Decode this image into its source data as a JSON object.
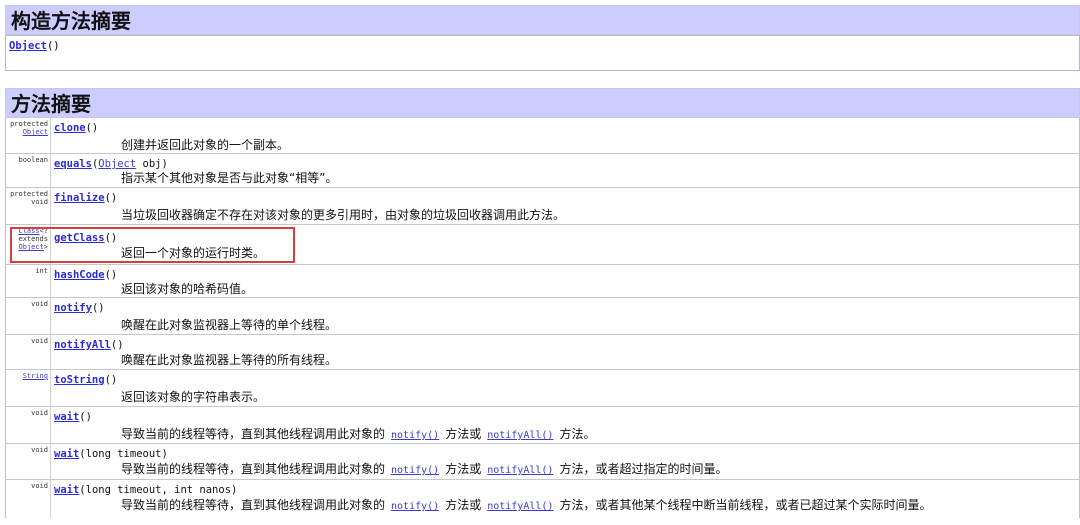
{
  "constructor_summary": {
    "title": "构造方法摘要",
    "constructor_link": "Object",
    "constructor_suffix": "()"
  },
  "method_summary": {
    "title": "方法摘要",
    "rows": [
      {
        "mod_line1": "protected",
        "mod_type": "Object",
        "name": "clone",
        "params": "()",
        "desc": "创建并返回此对象的一个副本。"
      },
      {
        "mod_line1": "boolean",
        "name": "equals",
        "params_prefix": "(",
        "param_type": "Object",
        "params_suffix": " obj)",
        "desc": "指示某个其他对象是否与此对象“相等”。"
      },
      {
        "mod_line1": "protected",
        "mod_line2": "void",
        "name": "finalize",
        "params": "()",
        "desc": "当垃圾回收器确定不存在对该对象的更多引用时，由对象的垃圾回收器调用此方法。"
      },
      {
        "mod_type": "Class",
        "mod_line1b": "<?",
        "mod_line2": "extends",
        "mod_type2": "Object",
        "mod_line3b": ">",
        "name": "getClass",
        "params": "()",
        "desc": "返回一个对象的运行时类。"
      },
      {
        "mod_line1": "int",
        "name": "hashCode",
        "params": "()",
        "desc": "返回该对象的哈希码值。"
      },
      {
        "mod_line1": "void",
        "name": "notify",
        "params": "()",
        "desc": "唤醒在此对象监视器上等待的单个线程。"
      },
      {
        "mod_line1": "void",
        "name": "notifyAll",
        "params": "()",
        "desc": "唤醒在此对象监视器上等待的所有线程。"
      },
      {
        "mod_type": "String",
        "name": "toString",
        "params": "()",
        "desc": "返回该对象的字符串表示。"
      },
      {
        "mod_line1": "void",
        "name": "wait",
        "params": "()",
        "desc_a": "导致当前的线程等待，直到其他线程调用此对象的",
        "link1": "notify()",
        "desc_b": "方法或",
        "link2": "notifyAll()",
        "desc_c": "方法。"
      },
      {
        "mod_line1": "void",
        "name": "wait",
        "params": "(long timeout)",
        "desc_a": "导致当前的线程等待，直到其他线程调用此对象的",
        "link1": "notify()",
        "desc_b": "方法或",
        "link2": "notifyAll()",
        "desc_c": "方法，或者超过指定的时间量。"
      },
      {
        "mod_line1": "void",
        "name": "wait",
        "params": "(long timeout, int nanos)",
        "desc_a": "导致当前的线程等待，直到其他线程调用此对象的",
        "link1": "notify()",
        "desc_b": "方法或",
        "link2": "notifyAll()",
        "desc_c": "方法，或者其他某个线程中断当前线程，或者已超过某个实际时间量。"
      }
    ]
  },
  "colors": {
    "header_bg": "#ccccff",
    "link": "#2a2ad8",
    "highlight_border": "#d04040"
  }
}
